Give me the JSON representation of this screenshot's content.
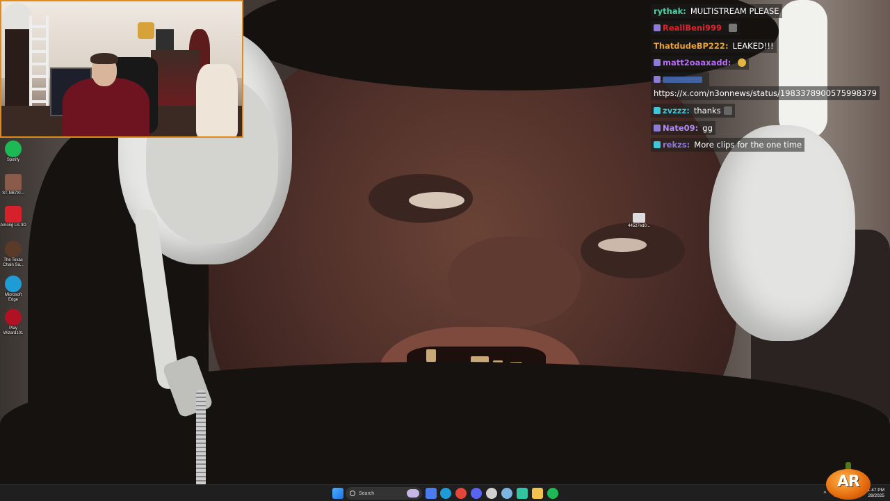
{
  "chat": {
    "messages": [
      {
        "user": "rythak:",
        "text": "MULTISTREAM PLEASE",
        "color": "#4fd1a5",
        "badge": false,
        "emote": false
      },
      {
        "user": "ReallBeni999",
        "text": "",
        "color": "#d8242e",
        "badge": true,
        "emote": true
      },
      {
        "user": "ThatdudeBP222:",
        "text": "LEAKED!!!",
        "color": "#e6a23c",
        "badge": false,
        "emote": false
      },
      {
        "user": "matt2oaaxadd:",
        "text": "",
        "color": "#b56cf0",
        "badge": true,
        "emote": true
      },
      {
        "user": "",
        "text": "",
        "color": "#4a76c9",
        "badge": true,
        "emote": false
      },
      {
        "user": "",
        "text": "https://x.com/n3onnews/status/1983378900575998379",
        "color": "#ffffff",
        "badge": false,
        "emote": false
      },
      {
        "user": "zvzzz:",
        "text": "thanks",
        "color": "#3fc7d9",
        "badge": true,
        "emote": true
      },
      {
        "user": "Nate09:",
        "text": "gg",
        "color": "#b28cf0",
        "badge": true,
        "emote": false
      },
      {
        "user": "rekzs:",
        "text": "More clips for the one time",
        "color": "#8e7bd6",
        "badge": true,
        "emote": false
      }
    ]
  },
  "desktop": {
    "icons": [
      {
        "name": "spotify-icon",
        "label": "Spotify",
        "color": "#1db954"
      },
      {
        "name": "video-thumb-icon",
        "label": "ST-NB7XI...",
        "color": "#8a5a4a"
      },
      {
        "name": "among-us-icon",
        "label": "Among Us 3D",
        "color": "#d6202c"
      },
      {
        "name": "texas-chainsaw-icon",
        "label": "The Texas Chain Sa...",
        "color": "#5a3b2a"
      },
      {
        "name": "edge-icon",
        "label": "Microsoft Edge",
        "color": "#1f9bd6"
      },
      {
        "name": "wizard101-icon",
        "label": "Play Wizard101",
        "color": "#b01224"
      }
    ],
    "cursor_file_label": "44527ed0..."
  },
  "taskbar": {
    "search_label": "Search",
    "pinned": [
      {
        "name": "copilot-icon",
        "color": "#4a7cf0"
      },
      {
        "name": "edge-taskbar-icon",
        "color": "#1f9bd6"
      },
      {
        "name": "chrome-icon",
        "color": "#e5463b"
      },
      {
        "name": "discord-icon",
        "color": "#5865f2"
      },
      {
        "name": "obs-icon",
        "color": "#d0d0d0"
      },
      {
        "name": "steam-icon",
        "color": "#7db5e0"
      },
      {
        "name": "streamlabs-icon",
        "color": "#31c3a2"
      },
      {
        "name": "file-explorer-icon",
        "color": "#f2c14e"
      },
      {
        "name": "spotify-taskbar-icon",
        "color": "#1db954"
      }
    ],
    "clock_time": "11:47 PM",
    "clock_date": "28/2025",
    "tray_chevron": "^"
  },
  "logo": {
    "text": "AR"
  }
}
